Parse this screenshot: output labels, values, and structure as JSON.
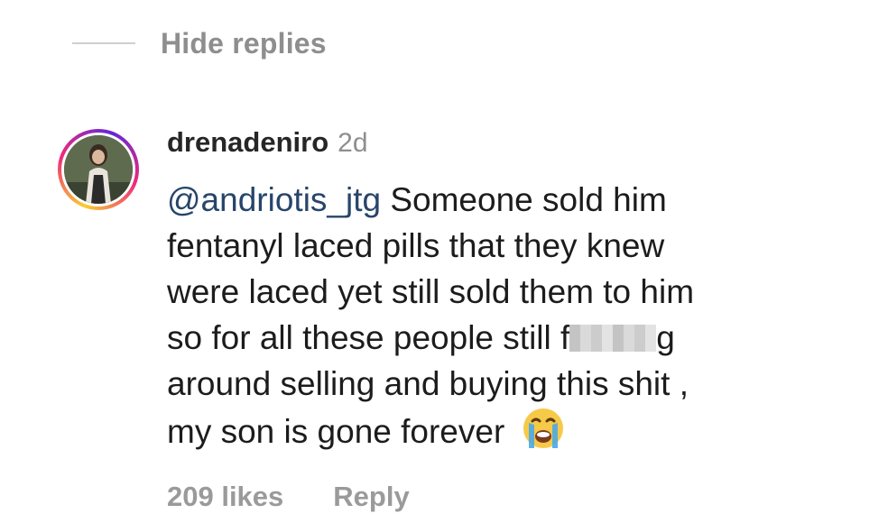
{
  "thread": {
    "hide_replies_label": "Hide replies"
  },
  "comment": {
    "username": "drenadeniro",
    "timestamp": "2d",
    "mention": "@andriotis_jtg",
    "lines": [
      "Someone sold him",
      "fentanyl laced pills that they knew",
      "were laced yet still sold them to him",
      "so for all these people still f",
      "g",
      "around selling and buying this shit ,",
      "my son is gone forever"
    ],
    "emoji": "loudly-crying-face-icon",
    "likes": "209 likes",
    "reply_label": "Reply"
  },
  "colors": {
    "accent_gray": "#8e8e8e",
    "mention_blue": "#27456a",
    "ring_gradient": [
      "#f9ce34",
      "#ee2a7b",
      "#6228d7"
    ]
  }
}
